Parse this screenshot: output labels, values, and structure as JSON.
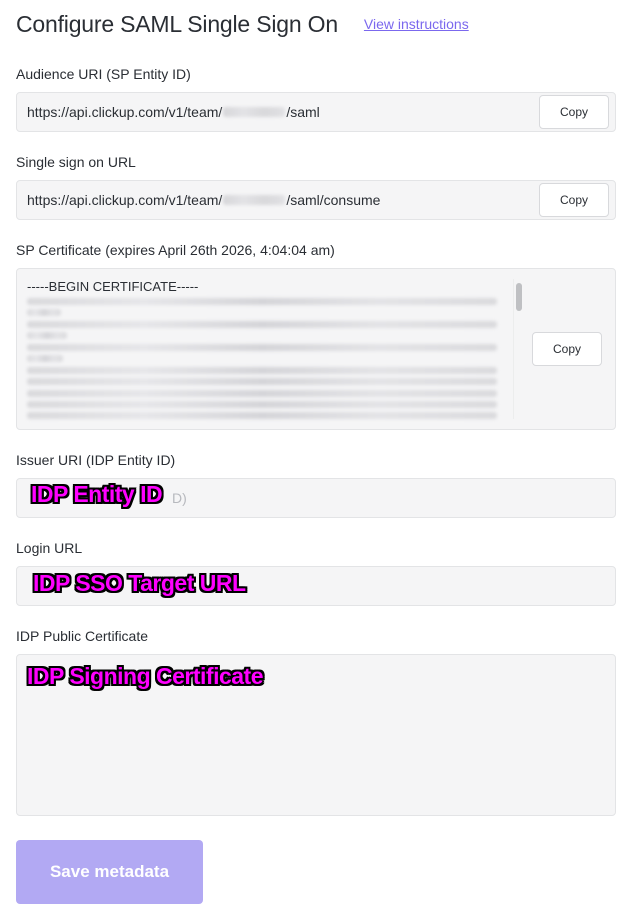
{
  "header": {
    "title": "Configure SAML Single Sign On",
    "instructions_link": "View instructions"
  },
  "audience": {
    "label": "Audience URI (SP Entity ID)",
    "value_prefix": "https://api.clickup.com/v1/team/",
    "value_suffix": "/saml",
    "copy_label": "Copy"
  },
  "sso_url": {
    "label": "Single sign on URL",
    "value_prefix": "https://api.clickup.com/v1/team/",
    "value_suffix": "/saml/consume",
    "copy_label": "Copy"
  },
  "sp_certificate": {
    "label": "SP Certificate (expires April 26th 2026, 4:04:04 am)",
    "first_line": "-----BEGIN CERTIFICATE-----",
    "copy_label": "Copy"
  },
  "issuer": {
    "label": "Issuer URI (IDP Entity ID)",
    "placeholder_tail": "D)",
    "overlay": "IDP Entity ID"
  },
  "login": {
    "label": "Login URL",
    "overlay": "IDP SSO Target URL"
  },
  "idp_certificate": {
    "label": "IDP Public Certificate",
    "overlay": "IDP Signing Certificate"
  },
  "save_label": "Save metadata",
  "colors": {
    "accent": "#7b68ee",
    "save_button": "#b2a9f3",
    "overlay_text": "#ff00ff",
    "field_background": "#f5f5f6"
  }
}
